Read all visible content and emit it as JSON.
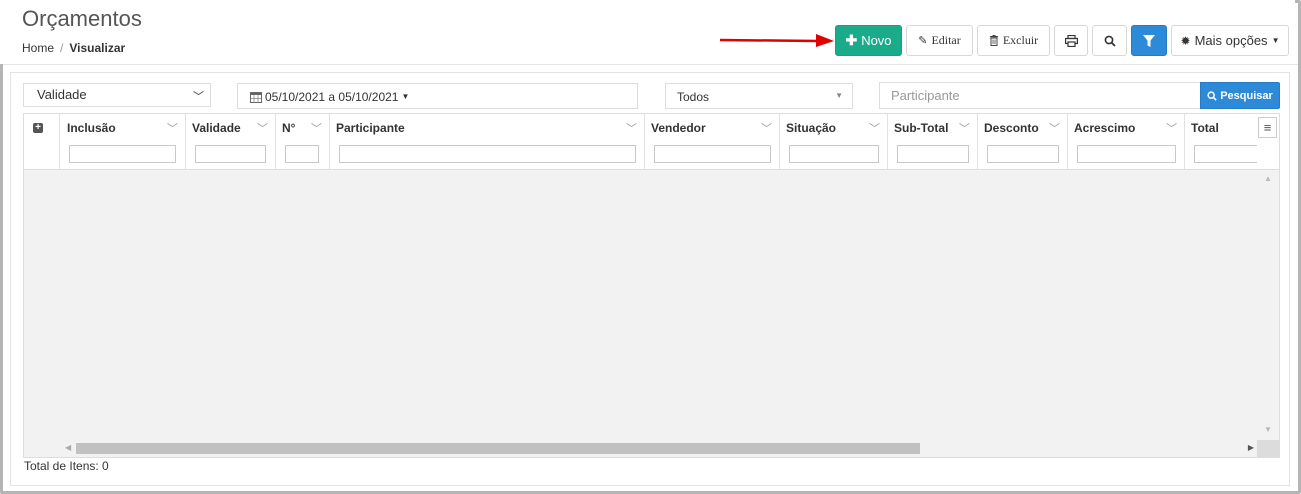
{
  "header": {
    "title": "Orçamentos",
    "breadcrumb": {
      "home": "Home",
      "separator": "/",
      "current": "Visualizar"
    }
  },
  "toolbar": {
    "novo_label": "Novo",
    "editar_label": "Editar",
    "excluir_label": "Excluir",
    "mais_opcoes_label": "Mais opções",
    "primary_color": "#1aab8b",
    "accent_color": "#2c8ad8"
  },
  "filters": {
    "date_type_selected": "Validade",
    "date_range": "05/10/2021 a 05/10/2021",
    "status_selected": "Todos",
    "participant_placeholder": "Participante",
    "search_label": "Pesquisar"
  },
  "grid": {
    "columns": [
      "Inclusão",
      "Validade",
      "N°",
      "Participante",
      "Vendedor",
      "Situação",
      "Sub-Total",
      "Desconto",
      "Acrescimo",
      "Total"
    ],
    "rows": []
  },
  "footer": {
    "total_label": "Total de Itens: 0"
  }
}
